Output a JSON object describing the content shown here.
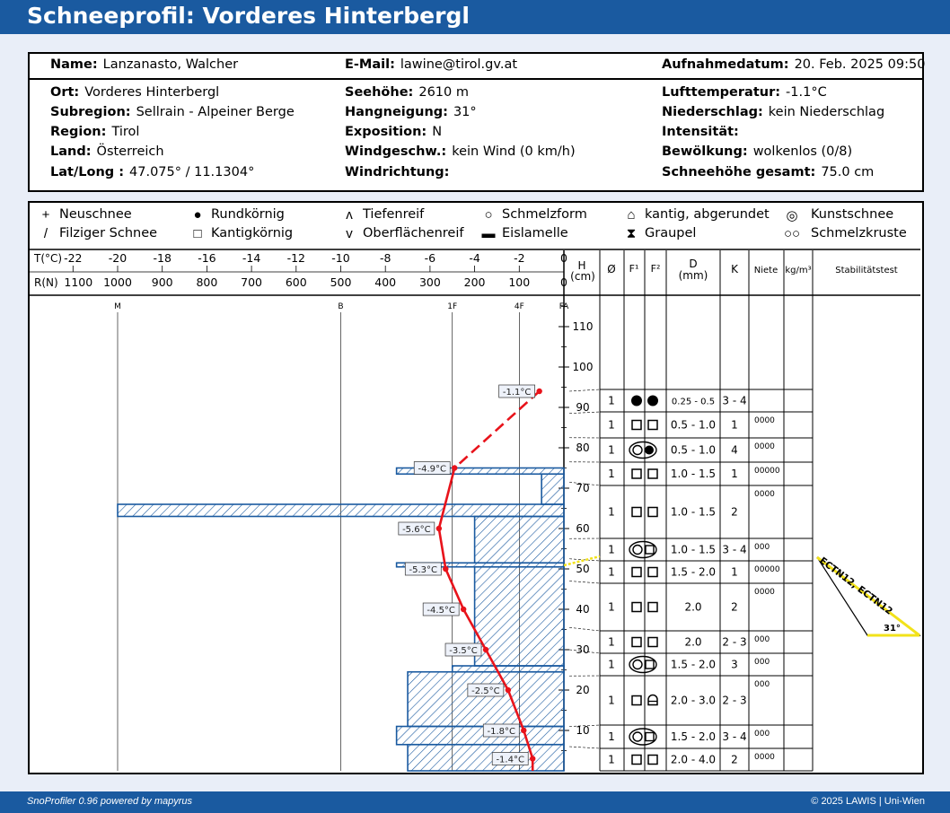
{
  "header": {
    "title": "Schneeprofil: Vorderes Hinterbergl"
  },
  "info": {
    "name_label": "Name:",
    "name": "Lanzanasto, Walcher",
    "email_label": "E-Mail:",
    "email": "lawine@tirol.gv.at",
    "date_label": "Aufnahmedatum:",
    "date": "20. Feb. 2025 09:50",
    "ort_label": "Ort:",
    "ort": "Vorderes Hinterbergl",
    "subregion_label": "Subregion:",
    "subregion": "Sellrain - Alpeiner Berge",
    "region_label": "Region:",
    "region": "Tirol",
    "land_label": "Land:",
    "land": "Österreich",
    "latlong_label": "Lat/Long :",
    "latlong": "47.075° / 11.1304°",
    "seehoehe_label": "Seehöhe:",
    "seehoehe": "2610 m",
    "hang_label": "Hangneigung:",
    "hang": "31°",
    "exp_label": "Exposition:",
    "exp": "N",
    "wind_label": "Windgeschw.:",
    "wind": "kein Wind (0 km/h)",
    "windr_label": "Windrichtung:",
    "windr": "",
    "luft_label": "Lufttemperatur:",
    "luft": "-1.1°C",
    "nieder_label": "Niederschlag:",
    "nieder": "kein Niederschlag",
    "intens_label": "Intensität:",
    "intens": "",
    "bew_label": "Bewölkung:",
    "bew": "wolkenlos (0/8)",
    "hs_label": "Schneehöhe gesamt:",
    "hs": "75.0 cm"
  },
  "legend": [
    {
      "icon": "plus-icon",
      "symbol": "+",
      "label": "Neuschnee"
    },
    {
      "icon": "filled-circle-icon",
      "symbol": "●",
      "label": "Rundkörnig"
    },
    {
      "icon": "caret-up-icon",
      "symbol": "ʌ",
      "label": "Tiefenreif"
    },
    {
      "icon": "open-circle-icon",
      "symbol": "○",
      "label": "Schmelzform"
    },
    {
      "icon": "lock-shape-icon",
      "symbol": "⌂",
      "label": "kantig, abgerundet"
    },
    {
      "icon": "double-circle-icon",
      "symbol": "◎",
      "label": "Kunstschnee"
    },
    {
      "icon": "slash-icon",
      "symbol": "/",
      "label": "Filziger Schnee"
    },
    {
      "icon": "open-square-icon",
      "symbol": "□",
      "label": "Kantigkörnig"
    },
    {
      "icon": "v-icon",
      "symbol": "v",
      "label": "Oberflächenreif"
    },
    {
      "icon": "black-bar-icon",
      "symbol": "▬",
      "label": "Eislamelle"
    },
    {
      "icon": "hourglass-icon",
      "symbol": "⧗",
      "label": "Graupel"
    },
    {
      "icon": "linked-circles-icon",
      "symbol": "○○",
      "label": "Schmelzkruste"
    }
  ],
  "axes": {
    "t_label": "T(°C)",
    "t_ticks": [
      "-22",
      "-20",
      "-18",
      "-16",
      "-14",
      "-12",
      "-10",
      "-8",
      "-6",
      "-4",
      "-2",
      "0"
    ],
    "r_label": "R(N)",
    "r_ticks": [
      "1100",
      "1000",
      "900",
      "800",
      "700",
      "600",
      "500",
      "400",
      "300",
      "200",
      "100",
      "0"
    ],
    "h_label": "H",
    "h_unit": "(cm)",
    "h_ticks": [
      "10",
      "20",
      "30",
      "40",
      "50",
      "60",
      "70",
      "80",
      "90",
      "100",
      "110"
    ],
    "hand_labels": [
      "M",
      "B",
      "1F",
      "4F",
      "FA"
    ]
  },
  "columns": {
    "oe": "Ø",
    "f1": "F¹",
    "f2": "F²",
    "d": "D",
    "d_unit": "(mm)",
    "k": "K",
    "niete": "Niete",
    "density": "kg/m³",
    "stab": "Stabilitätstest"
  },
  "stability": {
    "label": "ECTN12, ECTN12",
    "angle": "31°",
    "height_cm": 50
  },
  "chart_data": {
    "type": "line",
    "title": "",
    "xlabel": "T(°C)",
    "ylabel": "H (cm)",
    "xlim": [
      -22,
      0
    ],
    "ylim": [
      0,
      118
    ],
    "temperature_profile": [
      {
        "h": 94,
        "t": -1.1,
        "label": "-1.1°C",
        "dashed": true
      },
      {
        "h": 75,
        "t": -4.9,
        "label": "-4.9°C"
      },
      {
        "h": 60,
        "t": -5.6,
        "label": "-5.6°C"
      },
      {
        "h": 50,
        "t": -5.3,
        "label": "-5.3°C"
      },
      {
        "h": 40,
        "t": -4.5,
        "label": "-4.5°C"
      },
      {
        "h": 30,
        "t": -3.5,
        "label": "-3.5°C"
      },
      {
        "h": 20,
        "t": -2.5,
        "label": "-2.5°C"
      },
      {
        "h": 10,
        "t": -1.8,
        "label": "-1.8°C"
      },
      {
        "h": 3,
        "t": -1.4,
        "label": "-1.4°C"
      },
      {
        "h": 0,
        "t": -1.4,
        "label": ""
      }
    ],
    "hardness_profile": [
      {
        "top": 75.0,
        "bottom": 73.5,
        "r": 375
      },
      {
        "top": 73.5,
        "bottom": 66.0,
        "r": 50
      },
      {
        "top": 66.0,
        "bottom": 63.0,
        "r": 1000
      },
      {
        "top": 63.0,
        "bottom": 51.5,
        "r": 200
      },
      {
        "top": 51.5,
        "bottom": 50.5,
        "r": 375
      },
      {
        "top": 50.5,
        "bottom": 26.0,
        "r": 200
      },
      {
        "top": 26.0,
        "bottom": 24.5,
        "r": 250
      },
      {
        "top": 24.5,
        "bottom": 11.0,
        "r": 350
      },
      {
        "top": 11.0,
        "bottom": 6.5,
        "r": 375
      },
      {
        "top": 6.5,
        "bottom": 0.0,
        "r": 350
      }
    ],
    "layers": [
      {
        "top": 94.0,
        "bottom": 88.5,
        "oe": "1",
        "f1": "filled-circle",
        "f2": "filled-circle",
        "d": "0.25 - 0.5",
        "k": "3 - 4",
        "niete": ""
      },
      {
        "top": 88.5,
        "bottom": 82.5,
        "oe": "1",
        "f1": "open-square",
        "f2": "open-square",
        "d": "0.5 - 1.0",
        "k": "1",
        "niete": "0000"
      },
      {
        "top": 82.5,
        "bottom": 76.5,
        "oe": "1",
        "f1": "melt-crust",
        "f2": "filled-circle",
        "d": "0.5 - 1.0",
        "k": "4",
        "niete": "0000"
      },
      {
        "top": 76.5,
        "bottom": 71.5,
        "oe": "1",
        "f1": "open-square",
        "f2": "open-square",
        "d": "1.0 - 1.5",
        "k": "1",
        "niete": "00000"
      },
      {
        "top": 71.5,
        "bottom": 57.5,
        "oe": "1",
        "f1": "open-square",
        "f2": "open-square",
        "d": "1.0 - 1.5",
        "k": "2",
        "niete": "0000"
      },
      {
        "top": 57.5,
        "bottom": 52.5,
        "oe": "1",
        "f1": "melt-crust",
        "f2": "open-square",
        "d": "1.0 - 1.5",
        "k": "3 - 4",
        "niete": "000"
      },
      {
        "top": 52.5,
        "bottom": 47.0,
        "oe": "1",
        "f1": "open-square",
        "f2": "open-square",
        "d": "1.5 - 2.0",
        "k": "1",
        "niete": "00000"
      },
      {
        "top": 47.0,
        "bottom": 35.5,
        "oe": "1",
        "f1": "open-square",
        "f2": "open-square",
        "d": "2.0",
        "k": "2",
        "niete": "0000"
      },
      {
        "top": 35.5,
        "bottom": 30.0,
        "oe": "1",
        "f1": "open-square",
        "f2": "open-square",
        "d": "2.0",
        "k": "2 - 3",
        "niete": "000"
      },
      {
        "top": 30.0,
        "bottom": 23.5,
        "oe": "1",
        "f1": "melt-crust",
        "f2": "open-square",
        "d": "1.5 - 2.0",
        "k": "3",
        "niete": "000"
      },
      {
        "top": 23.5,
        "bottom": 11.0,
        "oe": "1",
        "f1": "open-square",
        "f2": "rounding-faceted",
        "d": "2.0 - 3.0",
        "k": "2 - 3",
        "niete": "000"
      },
      {
        "top": 11.0,
        "bottom": 6.0,
        "oe": "1",
        "f1": "melt-crust",
        "f2": "open-square",
        "d": "1.5 - 2.0",
        "k": "3 - 4",
        "niete": "000"
      },
      {
        "top": 6.0,
        "bottom": 0.0,
        "oe": "1",
        "f1": "open-square",
        "f2": "open-square",
        "d": "2.0 - 4.0",
        "k": "2",
        "niete": "0000"
      }
    ]
  },
  "footer": {
    "left": "SnoProfiler 0.96 powered by mapyrus",
    "right": "© 2025 LAWIS | Uni-Wien"
  }
}
